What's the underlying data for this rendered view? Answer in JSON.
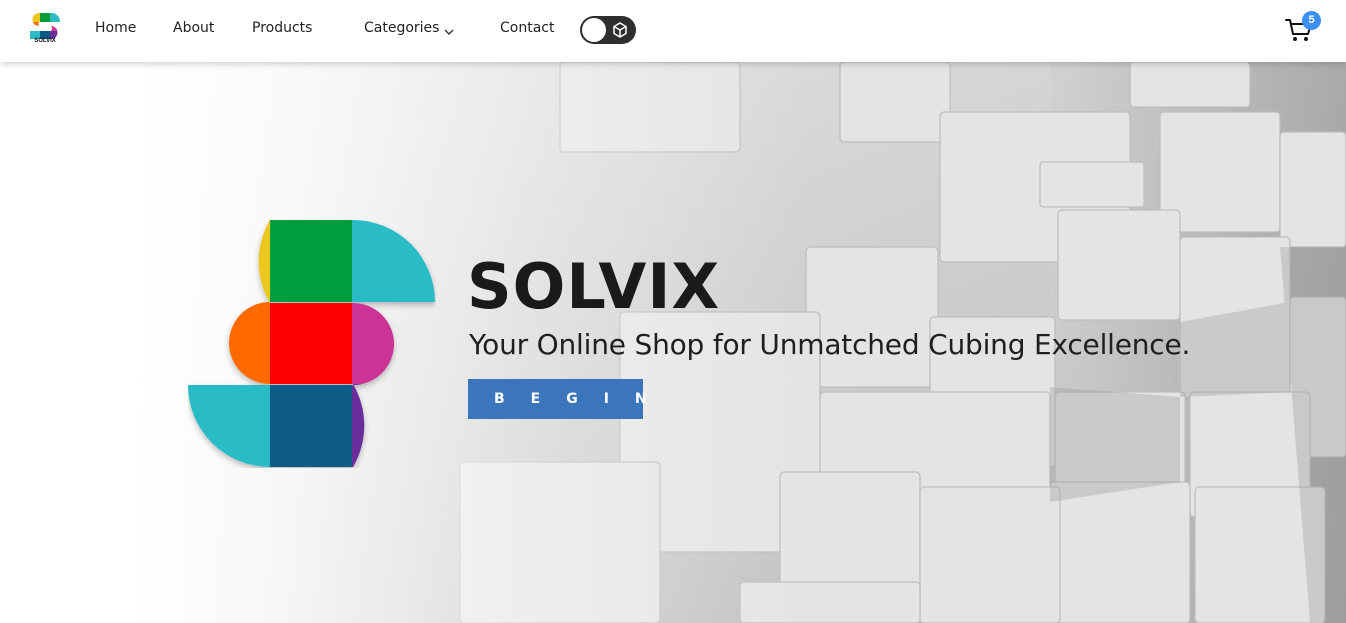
{
  "brand": {
    "logo_text": "SOLVIX"
  },
  "nav": {
    "home": "Home",
    "about": "About",
    "products": "Products",
    "categories": "Categories",
    "contact": "Contact"
  },
  "cart": {
    "count": "5"
  },
  "hero": {
    "title": "SOLVIX",
    "subtitle": "Your Online Shop for Unmatched Cubing Excellence.",
    "cta_label": "BEGIN"
  },
  "colors": {
    "accent": "#3b76bd",
    "badge": "#3d8ff2",
    "logo_tiles": [
      "#ecc81f",
      "#059c3c",
      "#2bbcc6",
      "#ff6a00",
      "#ff0000",
      "#cd3297",
      "#2bbcc6",
      "#0b5b87",
      "#6a2f9a"
    ]
  },
  "icons": [
    "chevron-down-icon",
    "cube-icon",
    "cart-icon"
  ]
}
